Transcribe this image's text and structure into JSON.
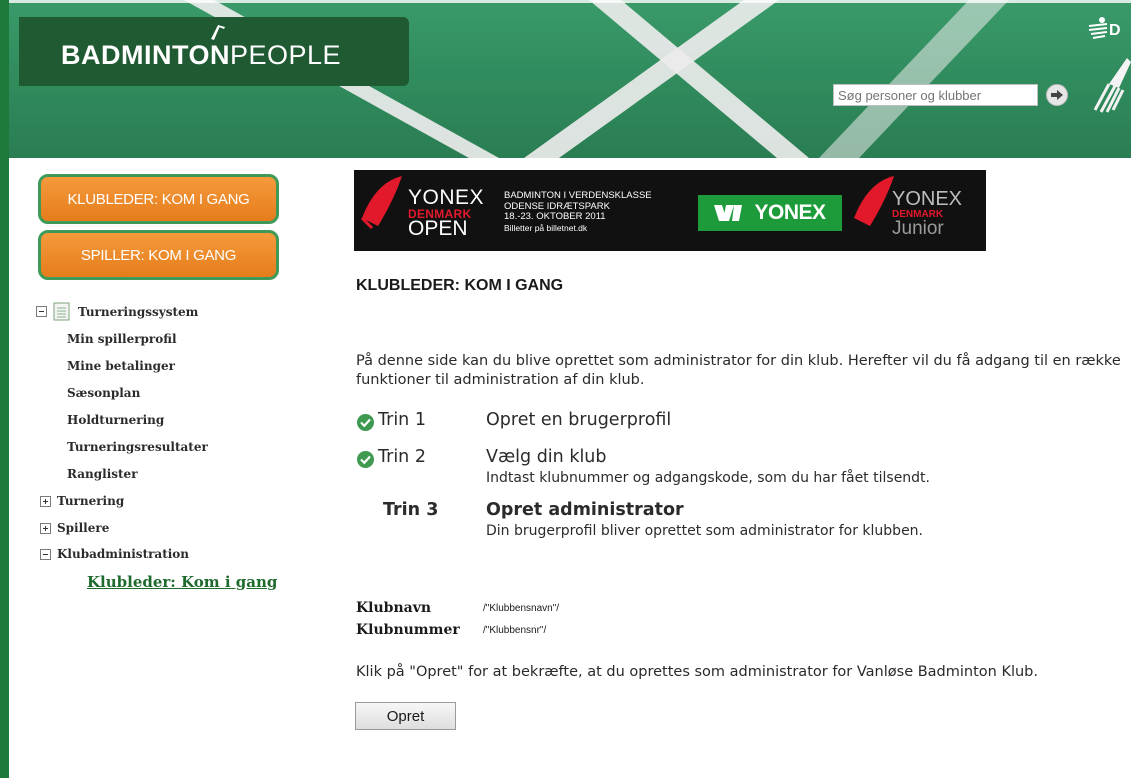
{
  "header": {
    "logo": {
      "bold": "BADMINTON",
      "light": "PEOPLE"
    },
    "search": {
      "placeholder": "Søg personer og klubber"
    },
    "corner_text": "D"
  },
  "sidebar": {
    "buttons": [
      {
        "label": "KLUBLEDER: KOM I GANG"
      },
      {
        "label": "SPILLER: KOM I GANG"
      }
    ],
    "tree": {
      "root": "Turneringssystem",
      "items": [
        "Min spillerprofil",
        "Mine betalinger",
        "Sæsonplan",
        "Holdturnering",
        "Turneringsresultater",
        "Ranglister"
      ],
      "groups": [
        {
          "label": "Turnering",
          "state": "collapsed"
        },
        {
          "label": "Spillere",
          "state": "collapsed"
        },
        {
          "label": "Klubadministration",
          "state": "expanded"
        }
      ],
      "active": "Klubleder: Kom i gang"
    }
  },
  "banner": {
    "left": {
      "line1": "YONEX",
      "line2": "DENMARK",
      "line3": "OPEN"
    },
    "info": [
      "BADMINTON I VERDENSKLASSE",
      "ODENSE IDRÆTSPARK",
      "18.-23. OKTOBER 2011",
      "Billetter på billetnet.dk"
    ],
    "brand": "YONEX",
    "right": {
      "line1": "YONEX",
      "line2": "DENMARK",
      "line3": "Junior"
    }
  },
  "main": {
    "title": "KLUBLEDER: KOM I GANG",
    "intro": "På denne side kan du blive oprettet som administrator for din klub. Herefter vil du få adgang til en række funktioner til administration af din klub.",
    "steps": [
      {
        "label": "Trin 1",
        "title": "Opret en brugerprofil",
        "desc": "",
        "done": true
      },
      {
        "label": "Trin 2",
        "title": "Vælg din klub",
        "desc": "Indtast klubnummer og adgangskode, som du har fået tilsendt.",
        "done": true
      },
      {
        "label": "Trin 3",
        "title": "Opret administrator",
        "desc": "Din brugerprofil bliver oprettet som administrator for klubben.",
        "done": false
      }
    ],
    "fields": [
      {
        "label": "Klubnavn",
        "value": "/\"Klubbensnavn\"/"
      },
      {
        "label": "Klubnummer",
        "value": "/\"Klubbensnr\"/"
      }
    ],
    "confirm": "Klik på \"Opret\" for at bekræfte, at du oprettes som administrator for Vanløse Badminton Klub.",
    "submit_label": "Opret"
  },
  "colors": {
    "brand_green": "#1f5a33",
    "header_green": "#2f8a5c",
    "orange": "#e57d1c",
    "link_green": "#1f6a2d",
    "check_green": "#3e9a50"
  }
}
